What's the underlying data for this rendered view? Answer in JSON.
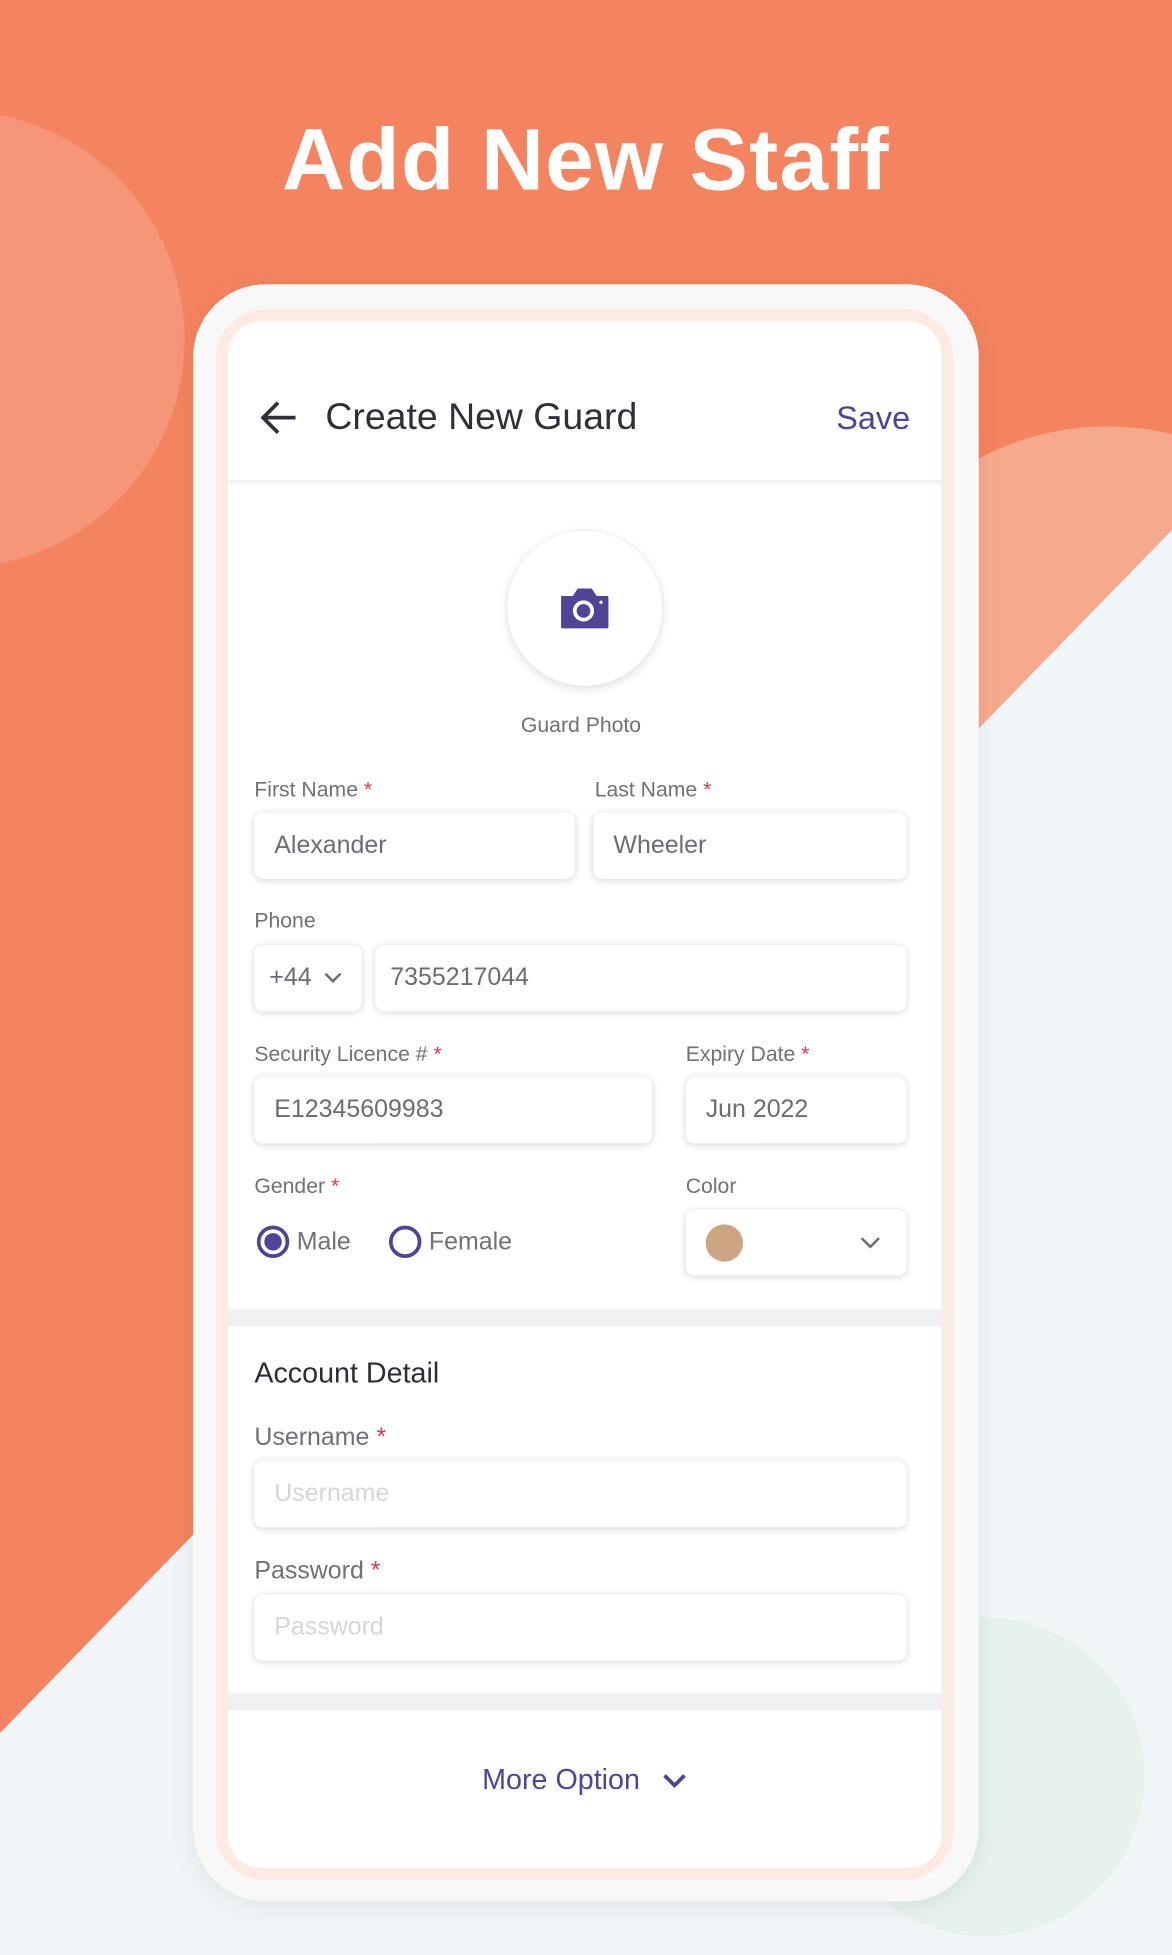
{
  "banner": {
    "title": "Add New Staff"
  },
  "colors": {
    "accent": "#4F4496",
    "background": "#F4845F",
    "required": "#E2374F",
    "selected_color": "#CBA680"
  },
  "header": {
    "back_icon": "arrow-left-icon",
    "title": "Create New Guard",
    "save_label": "Save"
  },
  "photo": {
    "icon": "camera-icon",
    "label": "Guard Photo"
  },
  "form": {
    "first_name": {
      "label": "First Name",
      "required": "*",
      "value": "Alexander"
    },
    "last_name": {
      "label": "Last Name",
      "required": "*",
      "value": "Wheeler"
    },
    "phone": {
      "label": "Phone",
      "country_code": "+44",
      "value": "7355217044"
    },
    "licence": {
      "label": "Security Licence #",
      "required": "*",
      "value": "E12345609983"
    },
    "expiry": {
      "label": "Expiry Date",
      "required": "*",
      "value": "Jun 2022"
    },
    "gender": {
      "label": "Gender",
      "required": "*",
      "options": [
        "Male",
        "Female"
      ],
      "selected": "Male"
    },
    "color": {
      "label": "Color"
    }
  },
  "account": {
    "heading": "Account Detail",
    "username": {
      "label": "Username",
      "required": "*",
      "placeholder": "Username"
    },
    "password": {
      "label": "Password",
      "required": "*",
      "placeholder": "Password"
    }
  },
  "more": {
    "label": "More Option"
  }
}
